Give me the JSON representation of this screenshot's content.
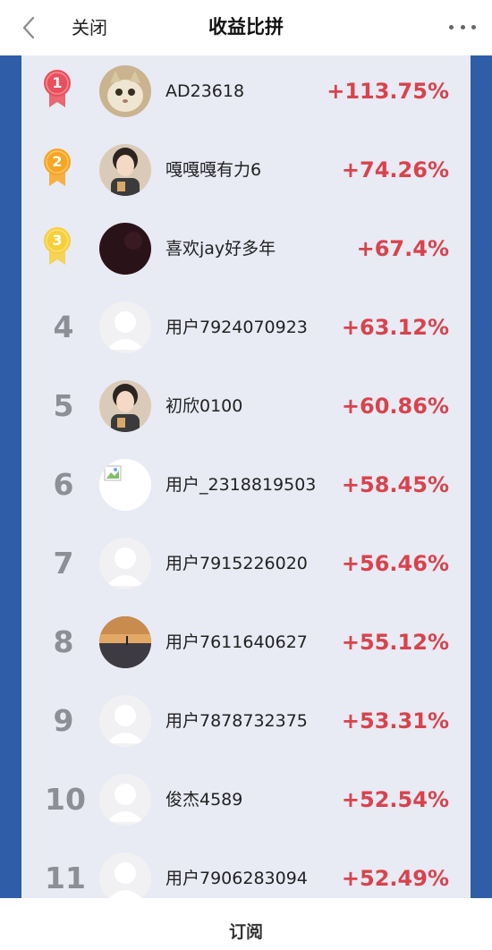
{
  "header": {
    "close_label": "关闭",
    "title": "收益比拼"
  },
  "rankings": [
    {
      "rank": "1",
      "name": "AD23618",
      "gain": "+113.75%",
      "medal": "red",
      "avatar": "cat-photo"
    },
    {
      "rank": "2",
      "name": "嘎嘎嘎有力6",
      "gain": "+74.26%",
      "medal": "orange",
      "avatar": "girl-photo"
    },
    {
      "rank": "3",
      "name": "喜欢jay好多年",
      "gain": "+67.4%",
      "medal": "yellow",
      "avatar": "dark-photo"
    },
    {
      "rank": "4",
      "name": "用户7924070923",
      "gain": "+63.12%",
      "avatar": "default-avatar"
    },
    {
      "rank": "5",
      "name": "初欣0100",
      "gain": "+60.86%",
      "avatar": "girl-photo"
    },
    {
      "rank": "6",
      "name": "用户_2318819503",
      "gain": "+58.45%",
      "avatar": "broken-image"
    },
    {
      "rank": "7",
      "name": "用户7915226020",
      "gain": "+56.46%",
      "avatar": "default-avatar"
    },
    {
      "rank": "8",
      "name": "用户7611640627",
      "gain": "+55.12%",
      "avatar": "sunset-photo"
    },
    {
      "rank": "9",
      "name": "用户7878732375",
      "gain": "+53.31%",
      "avatar": "default-avatar"
    },
    {
      "rank": "10",
      "name": "俊杰4589",
      "gain": "+52.54%",
      "avatar": "default-avatar"
    },
    {
      "rank": "11",
      "name": "用户7906283094",
      "gain": "+52.49%",
      "avatar": "default-avatar"
    }
  ],
  "footer": {
    "subscribe_label": "订阅"
  },
  "colors": {
    "accent_gain": "#d9434c",
    "frame_blue": "#2f5da8",
    "panel_bg": "#e8eaf4",
    "medal_red": "#e8505b",
    "medal_orange": "#f6a623",
    "medal_yellow": "#f7cf3b"
  }
}
